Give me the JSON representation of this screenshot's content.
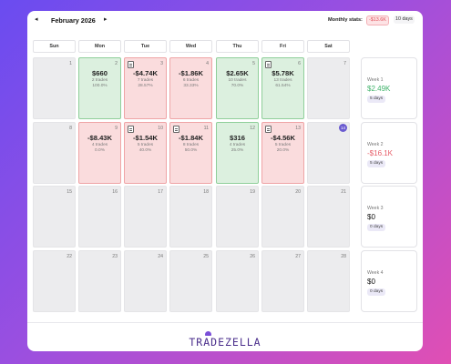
{
  "header": {
    "prev_icon": "◂",
    "next_icon": "▸",
    "month_label": "February 2026",
    "stats_label": "Monthly stats:",
    "stats_pnl": "-$13.6K",
    "stats_days": "10 days"
  },
  "weekdays": [
    "Sun",
    "Mon",
    "Tue",
    "Wed",
    "Thu",
    "Fri",
    "Sat"
  ],
  "days": [
    {
      "num": "1",
      "pnl": "",
      "trades": "",
      "rate": ""
    },
    {
      "num": "2",
      "pnl": "$660",
      "trades": "2 trades",
      "rate": "100.0%"
    },
    {
      "num": "3",
      "pnl": "-$4.74K",
      "trades": "7 trades",
      "rate": "28.57%"
    },
    {
      "num": "4",
      "pnl": "-$1.86K",
      "trades": "6 trades",
      "rate": "33.33%"
    },
    {
      "num": "5",
      "pnl": "$2.65K",
      "trades": "10 trades",
      "rate": "70.0%"
    },
    {
      "num": "6",
      "pnl": "$5.78K",
      "trades": "13 trades",
      "rate": "61.54%"
    },
    {
      "num": "7",
      "pnl": "",
      "trades": "",
      "rate": ""
    },
    {
      "num": "8",
      "pnl": "",
      "trades": "",
      "rate": ""
    },
    {
      "num": "9",
      "pnl": "-$8.43K",
      "trades": "4 trades",
      "rate": "0.0%"
    },
    {
      "num": "10",
      "pnl": "-$1.54K",
      "trades": "5 trades",
      "rate": "40.0%"
    },
    {
      "num": "11",
      "pnl": "-$1.84K",
      "trades": "8 trades",
      "rate": "50.0%"
    },
    {
      "num": "12",
      "pnl": "$316",
      "trades": "4 trades",
      "rate": "25.0%"
    },
    {
      "num": "13",
      "pnl": "-$4.56K",
      "trades": "5 trades",
      "rate": "20.0%"
    },
    {
      "num": "14",
      "pnl": "",
      "trades": "",
      "rate": ""
    },
    {
      "num": "15",
      "pnl": "",
      "trades": "",
      "rate": ""
    },
    {
      "num": "16",
      "pnl": "",
      "trades": "",
      "rate": ""
    },
    {
      "num": "17",
      "pnl": "",
      "trades": "",
      "rate": ""
    },
    {
      "num": "18",
      "pnl": "",
      "trades": "",
      "rate": ""
    },
    {
      "num": "19",
      "pnl": "",
      "trades": "",
      "rate": ""
    },
    {
      "num": "20",
      "pnl": "",
      "trades": "",
      "rate": ""
    },
    {
      "num": "21",
      "pnl": "",
      "trades": "",
      "rate": ""
    },
    {
      "num": "22",
      "pnl": "",
      "trades": "",
      "rate": ""
    },
    {
      "num": "23",
      "pnl": "",
      "trades": "",
      "rate": ""
    },
    {
      "num": "24",
      "pnl": "",
      "trades": "",
      "rate": ""
    },
    {
      "num": "25",
      "pnl": "",
      "trades": "",
      "rate": ""
    },
    {
      "num": "26",
      "pnl": "",
      "trades": "",
      "rate": ""
    },
    {
      "num": "27",
      "pnl": "",
      "trades": "",
      "rate": ""
    },
    {
      "num": "28",
      "pnl": "",
      "trades": "",
      "rate": ""
    }
  ],
  "weeks": [
    {
      "label": "Week 1",
      "pnl": "$2.49K",
      "days": "5 days"
    },
    {
      "label": "Week 2",
      "pnl": "-$16.1K",
      "days": "5 days"
    },
    {
      "label": "Week 3",
      "pnl": "$0",
      "days": "0 days"
    },
    {
      "label": "Week 4",
      "pnl": "$0",
      "days": "0 days"
    }
  ],
  "logo": {
    "text": "TRADEZELLA"
  },
  "colors": {
    "win": "#dcf0df",
    "loss": "#fadcdd",
    "positive": "#3fb26a",
    "negative": "#e65b66",
    "today": "#6a5bd0"
  }
}
